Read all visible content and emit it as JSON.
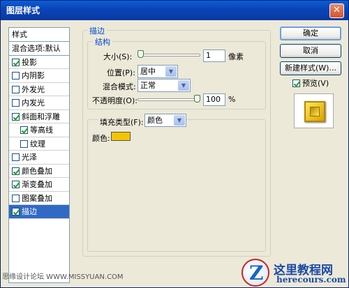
{
  "window": {
    "title": "图层样式",
    "close_glyph": "✕"
  },
  "style_list": {
    "header": "样式",
    "blend_options": "混合选项:默认",
    "items": [
      {
        "label": "投影",
        "checked": true,
        "sub": false,
        "selected": false
      },
      {
        "label": "内阴影",
        "checked": false,
        "sub": false,
        "selected": false
      },
      {
        "label": "外发光",
        "checked": false,
        "sub": false,
        "selected": false
      },
      {
        "label": "内发光",
        "checked": false,
        "sub": false,
        "selected": false
      },
      {
        "label": "斜面和浮雕",
        "checked": true,
        "sub": false,
        "selected": false
      },
      {
        "label": "等高线",
        "checked": true,
        "sub": true,
        "selected": false
      },
      {
        "label": "纹理",
        "checked": false,
        "sub": true,
        "selected": false
      },
      {
        "label": "光泽",
        "checked": false,
        "sub": false,
        "selected": false
      },
      {
        "label": "颜色叠加",
        "checked": true,
        "sub": false,
        "selected": false
      },
      {
        "label": "渐变叠加",
        "checked": true,
        "sub": false,
        "selected": false
      },
      {
        "label": "图案叠加",
        "checked": false,
        "sub": false,
        "selected": false
      },
      {
        "label": "描边",
        "checked": true,
        "sub": false,
        "selected": true
      }
    ]
  },
  "stroke": {
    "group_title": "描边",
    "structure_title": "结构",
    "size": {
      "label": "大小(S):",
      "value": "1",
      "unit": "像素",
      "slider_level": 0.0
    },
    "position": {
      "label": "位置(P):",
      "value": "居中"
    },
    "blend_mode": {
      "label": "混合模式:",
      "value": "正常"
    },
    "opacity": {
      "label": "不透明度(O):",
      "value": "100",
      "unit": "%",
      "slider_level": 1.0
    },
    "fill_type": {
      "label": "填充类型(F):",
      "value": "颜色"
    },
    "color": {
      "label": "颜色:",
      "hex": "#f5c400"
    }
  },
  "buttons": {
    "ok": "确定",
    "cancel": "取消",
    "new_style": "新建样式(W)...",
    "preview_label": "预览(V)",
    "preview_checked": true
  },
  "icons": {
    "close": "close-icon",
    "checkbox": "checkbox-icon",
    "dropdown": "chevron-down-icon"
  },
  "watermarks": {
    "left": "思缘设计论坛 WWW.MISSYUAN.COM",
    "logo_letter": "Z",
    "logo_title": "这里教程网",
    "logo_url": "herecours.com"
  }
}
